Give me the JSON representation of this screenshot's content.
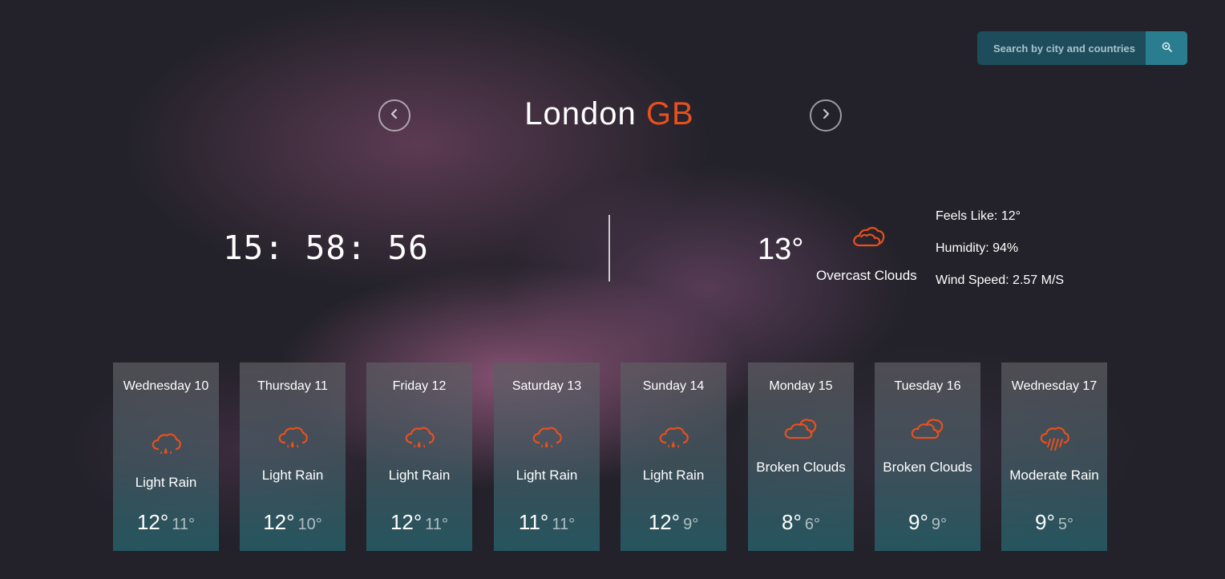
{
  "search": {
    "placeholder": "Search by city and countries",
    "icon": "search-icon"
  },
  "header": {
    "city": "London",
    "country": "GB",
    "prev_icon": "chevron-left-icon",
    "next_icon": "chevron-right-icon"
  },
  "clock": {
    "time": "15: 58: 56"
  },
  "current": {
    "temp": "13°",
    "description": "Overcast Clouds",
    "icon": "cloud-icon",
    "feels_like": "Feels Like: 12°",
    "humidity": "Humidity: 94%",
    "wind": "Wind Speed: 2.57 M/S"
  },
  "colors": {
    "accent": "#e8501d",
    "search_bg": "#1d4c5a",
    "search_button": "#2a7d8e"
  },
  "forecast": [
    {
      "day": "Wednesday 10",
      "description": "Light Rain",
      "high": "12°",
      "low": "11°",
      "icon": "cloud-rain-icon"
    },
    {
      "day": "Thursday 11",
      "description": "Light Rain",
      "high": "12°",
      "low": "10°",
      "icon": "cloud-rain-icon"
    },
    {
      "day": "Friday 12",
      "description": "Light Rain",
      "high": "12°",
      "low": "11°",
      "icon": "cloud-rain-icon"
    },
    {
      "day": "Saturday 13",
      "description": "Light Rain",
      "high": "11°",
      "low": "11°",
      "icon": "cloud-rain-icon"
    },
    {
      "day": "Sunday 14",
      "description": "Light Rain",
      "high": "12°",
      "low": "9°",
      "icon": "cloud-rain-icon"
    },
    {
      "day": "Monday 15",
      "description": "Broken Clouds",
      "high": "8°",
      "low": "6°",
      "icon": "clouds-icon"
    },
    {
      "day": "Tuesday 16",
      "description": "Broken Clouds",
      "high": "9°",
      "low": "9°",
      "icon": "clouds-icon"
    },
    {
      "day": "Wednesday 17",
      "description": "Moderate Rain",
      "high": "9°",
      "low": "5°",
      "icon": "cloud-showers-icon"
    }
  ]
}
